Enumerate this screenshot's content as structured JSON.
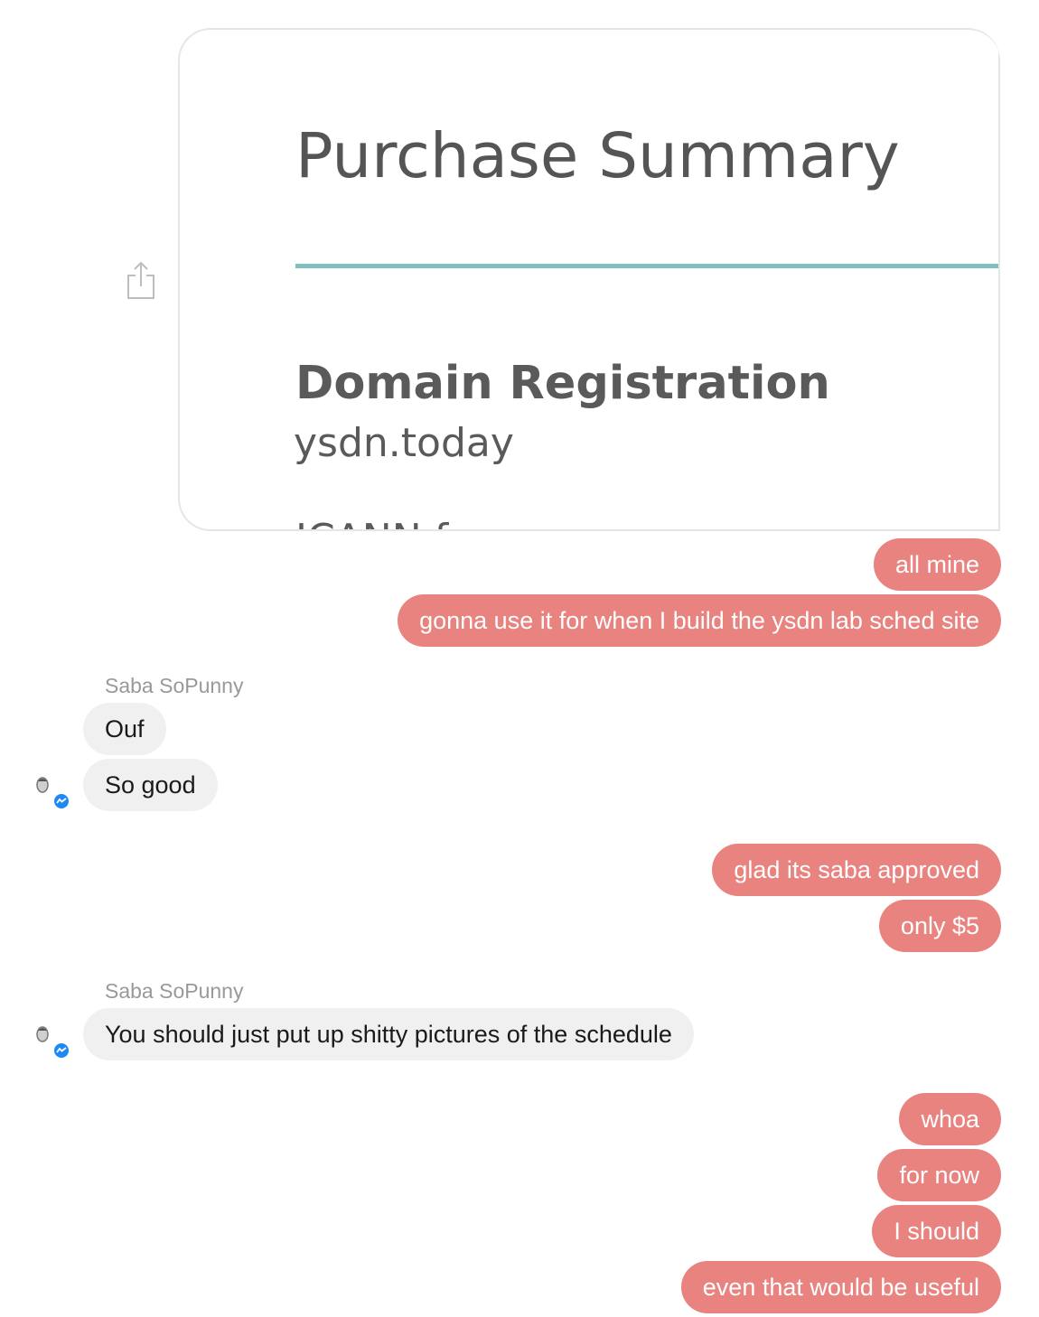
{
  "attachment": {
    "title": "Purchase Summary",
    "heading": "Domain Registration",
    "domain": "ysdn.today",
    "cutoff_text": "ICANN f",
    "rule_color": "#7fbfbd",
    "share_icon": "share-icon"
  },
  "colors": {
    "outgoing_bubble": "#e8837f",
    "incoming_bubble": "#f0f0f0",
    "messenger_badge": "#1e88f5"
  },
  "messages": {
    "m1": "all mine",
    "m2": "gonna use it for when I build the ysdn lab sched site",
    "m3_sender": "Saba SoPunny",
    "m3": "Ouf",
    "m4": "So good",
    "m5": "glad its saba approved",
    "m6": "only $5",
    "m7_sender": "Saba SoPunny",
    "m7": "You should just put up shitty pictures of the schedule",
    "m8": "whoa",
    "m9": "for now",
    "m10": "I should",
    "m11": "even that would be useful"
  }
}
